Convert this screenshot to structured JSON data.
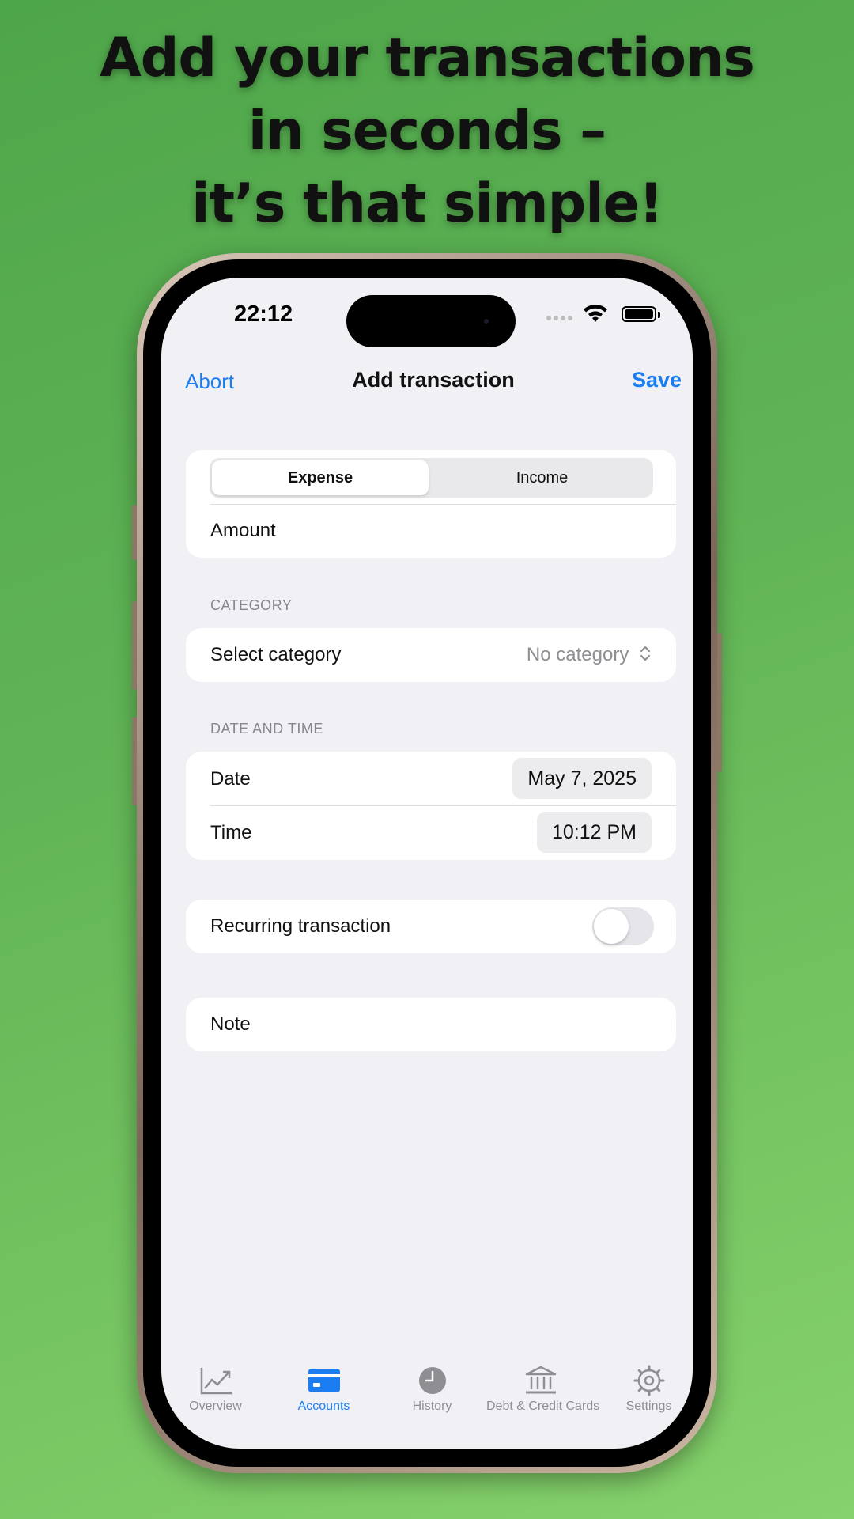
{
  "promo": {
    "line1": "Add your transactions",
    "line2": "in seconds –",
    "line3": "it’s that simple!"
  },
  "status_bar": {
    "time": "22:12",
    "icons": [
      "signal-dots-icon",
      "wifi-icon",
      "battery-icon"
    ]
  },
  "nav": {
    "abort_label": "Abort",
    "title": "Add transaction",
    "save_label": "Save"
  },
  "type_segment": {
    "options": [
      "Expense",
      "Income"
    ],
    "selected": "Expense"
  },
  "amount": {
    "placeholder": "Amount"
  },
  "category": {
    "header": "CATEGORY",
    "label": "Select category",
    "value": "No category"
  },
  "date_time": {
    "header": "DATE AND TIME",
    "date_label": "Date",
    "date_value": "May 7, 2025",
    "time_label": "Time",
    "time_value": "10:12 PM"
  },
  "recurring": {
    "label": "Recurring transaction",
    "on": false
  },
  "note": {
    "placeholder": "Note"
  },
  "tabbar": {
    "active": "Accounts",
    "items": [
      {
        "label": "Overview",
        "icon": "chart-line-icon"
      },
      {
        "label": "Accounts",
        "icon": "credit-card-icon"
      },
      {
        "label": "History",
        "icon": "clock-icon"
      },
      {
        "label": "Debt & Credit Cards",
        "icon": "bank-icon"
      },
      {
        "label": "Settings",
        "icon": "gear-icon"
      }
    ]
  },
  "colors": {
    "accent": "#1a7ef2",
    "background_green": "#62b556",
    "screen_bg": "#f1f0f5"
  }
}
